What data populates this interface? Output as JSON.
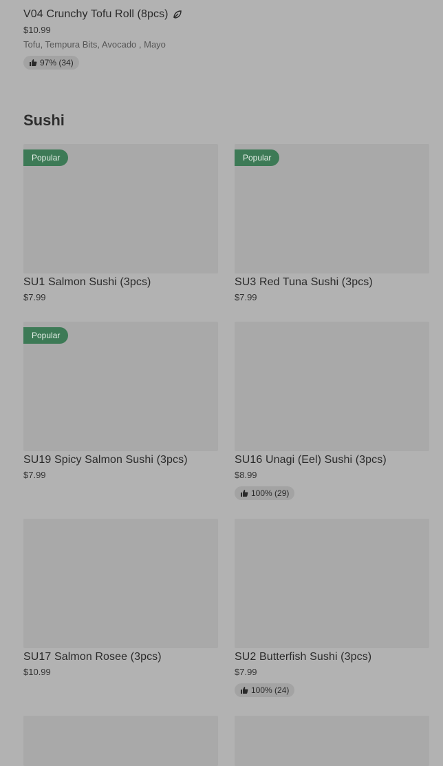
{
  "top_item": {
    "title": "V04 Crunchy Tofu Roll (8pcs)",
    "price": "$10.99",
    "description": "Tofu, Tempura Bits, Avocado , Mayo",
    "rating": "97% (34)",
    "icon": "leaf-icon"
  },
  "section": {
    "title": "Sushi"
  },
  "cards": [
    {
      "title": "SU1 Salmon Sushi (3pcs)",
      "price": "$7.99",
      "badge": "Popular",
      "rating": ""
    },
    {
      "title": "SU3 Red Tuna Sushi (3pcs)",
      "price": "$7.99",
      "badge": "Popular",
      "rating": ""
    },
    {
      "title": "SU19 Spicy Salmon Sushi (3pcs)",
      "price": "$7.99",
      "badge": "Popular",
      "rating": ""
    },
    {
      "title": "SU16 Unagi (Eel) Sushi (3pcs)",
      "price": "$8.99",
      "badge": "",
      "rating": "100% (29)"
    },
    {
      "title": "SU17 Salmon Rosee (3pcs)",
      "price": "$10.99",
      "badge": "",
      "rating": ""
    },
    {
      "title": "SU2 Butterfish Sushi (3pcs)",
      "price": "$7.99",
      "badge": "",
      "rating": "100% (24)"
    }
  ],
  "colors": {
    "badge": "#3d7a56",
    "background": "#b2b2b2",
    "image_placeholder": "#a9a9a9"
  }
}
